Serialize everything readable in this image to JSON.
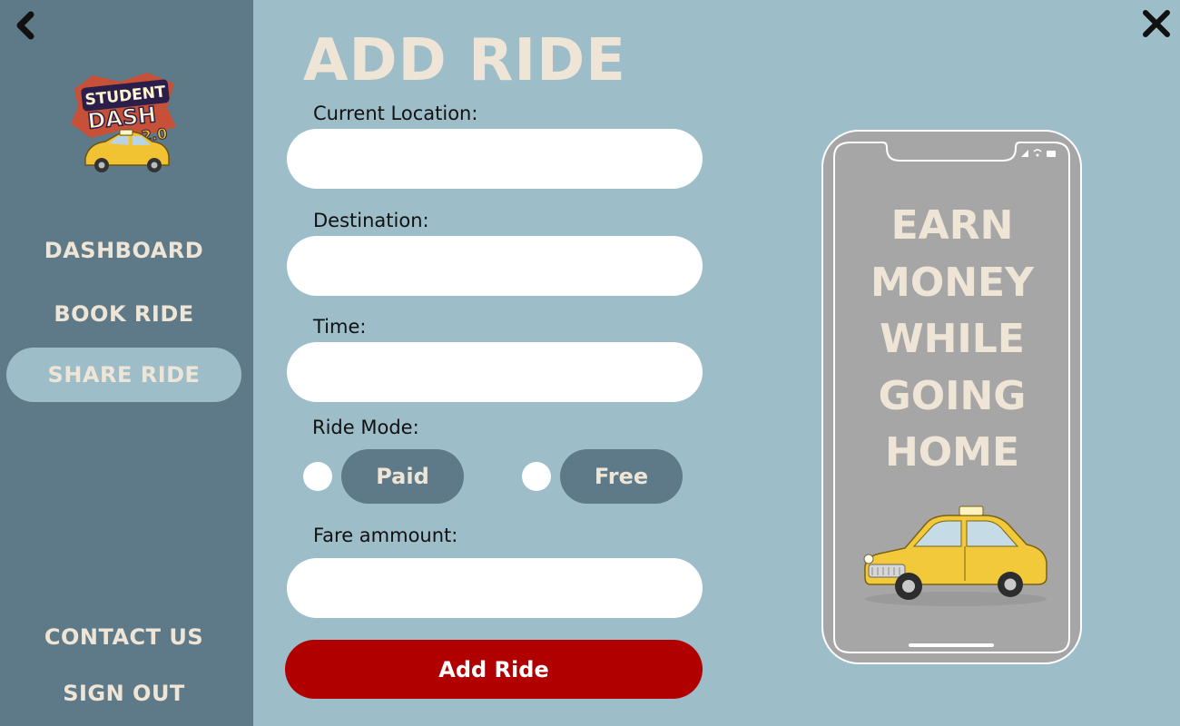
{
  "app": {
    "logo_text": "STUDENT DASH 2.0"
  },
  "sidebar": {
    "items": [
      {
        "label": "DASHBOARD"
      },
      {
        "label": "BOOK RIDE"
      },
      {
        "label": "SHARE RIDE",
        "active": true
      },
      {
        "label": "CONTACT US"
      },
      {
        "label": "SIGN OUT"
      }
    ]
  },
  "page": {
    "title": "ADD RIDE"
  },
  "form": {
    "current_location": {
      "label": "Current Location:",
      "value": ""
    },
    "destination": {
      "label": "Destination:",
      "value": ""
    },
    "time": {
      "label": "Time:",
      "value": ""
    },
    "ride_mode": {
      "label": "Ride Mode:",
      "options": [
        "Paid",
        "Free"
      ],
      "selected": null
    },
    "fare": {
      "label": "Fare ammount:",
      "value": ""
    },
    "submit_label": "Add Ride"
  },
  "promo": {
    "lines": [
      "EARN",
      "MONEY",
      "WHILE",
      "GOING",
      "HOME"
    ]
  },
  "colors": {
    "background": "#9dbdc9",
    "sidebar": "#5e7a88",
    "cream_text": "#efe5d6",
    "submit": "#b10000",
    "phone_screen": "#a6a6a6"
  },
  "icons": {
    "back": "chevron-left-icon",
    "close": "close-icon",
    "taxi": "taxi-icon"
  }
}
